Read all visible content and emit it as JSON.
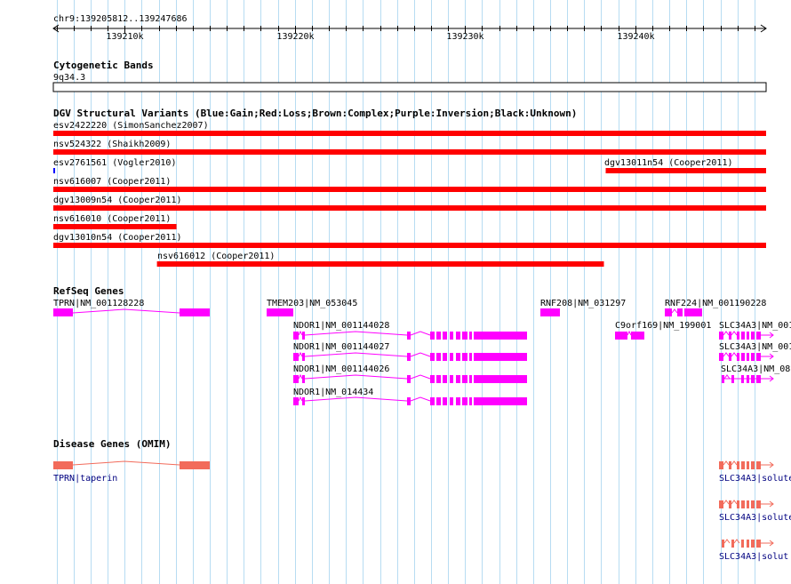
{
  "colors": {
    "grid": "#b7dcf2",
    "variant": "#ff0000",
    "variant_dot": "#0000ff",
    "gene": "#ff00ff",
    "disease": "#f26b5b",
    "disease_label": "#000080",
    "text": "#000000"
  },
  "ruler": {
    "coord_label": "chr9:139205812..139247686",
    "start": 139205812,
    "end": 139247686,
    "ticks": [
      "139210k",
      "139220k",
      "139230k",
      "139240k"
    ]
  },
  "cytoband": {
    "title": "Cytogenetic Bands",
    "band": "9q34.3"
  },
  "dgv": {
    "title": "DGV Structural Variants (Blue:Gain;Red:Loss;Brown:Complex;Purple:Inversion;Black:Unknown)",
    "items": [
      {
        "label": "esv2422220 (SimonSanchez2007)",
        "start": 139205812,
        "end": 139247686
      },
      {
        "label": "nsv524322 (Shaikh2009)",
        "start": 139205812,
        "end": 139247686
      },
      {
        "label": "esv2761561 (Vogler2010)",
        "start": 139205812,
        "end": 139205860
      },
      {
        "label": "dgv13011n54 (Cooper2011)",
        "start": 139238260,
        "end": 139247686
      },
      {
        "label": "nsv616007 (Cooper2011)",
        "start": 139205812,
        "end": 139247686
      },
      {
        "label": "dgv13009n54 (Cooper2011)",
        "start": 139205812,
        "end": 139247686
      },
      {
        "label": "nsv616010 (Cooper2011)",
        "start": 139205812,
        "end": 139213050
      },
      {
        "label": "dgv13010n54 (Cooper2011)",
        "start": 139205812,
        "end": 139247686
      },
      {
        "label": "nsv616012 (Cooper2011)",
        "start": 139211900,
        "end": 139238160
      }
    ]
  },
  "refseq": {
    "title": "RefSeq Genes",
    "genes": [
      {
        "label": "TPRN|NM_001128228"
      },
      {
        "label": "TMEM203|NM_053045"
      },
      {
        "label": "RNF208|NM_031297"
      },
      {
        "label": "RNF224|NM_001190228"
      },
      {
        "label": "NDOR1|NM_001144028"
      },
      {
        "label": "C9orf169|NM_199001"
      },
      {
        "label": "SLC34A3|NM_001"
      },
      {
        "label": "NDOR1|NM_001144027"
      },
      {
        "label": "SLC34A3|NM_001"
      },
      {
        "label": "NDOR1|NM_001144026"
      },
      {
        "label": "SLC34A3|NM_08"
      },
      {
        "label": "NDOR1|NM_014434"
      }
    ]
  },
  "omim": {
    "title": "Disease Genes (OMIM)",
    "genes": [
      {
        "label": "TPRN|taperin"
      },
      {
        "label": "SLC34A3|solute"
      },
      {
        "label": "SLC34A3|solute"
      },
      {
        "label": "SLC34A3|solut"
      }
    ]
  }
}
